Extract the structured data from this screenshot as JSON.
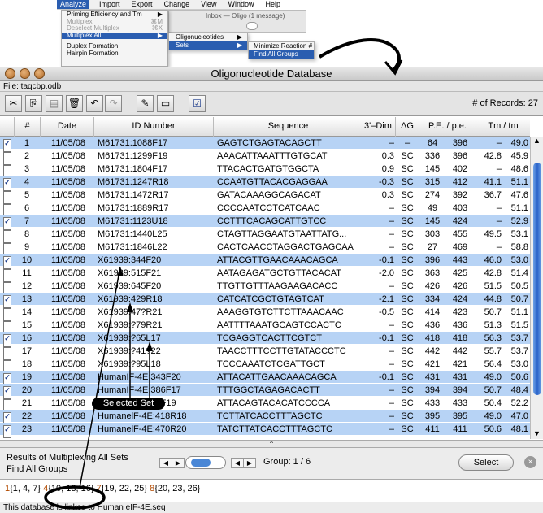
{
  "menubar": {
    "items": [
      "Analyze",
      "Import",
      "Export",
      "Change",
      "View",
      "Window",
      "Help"
    ]
  },
  "analyze_menu": {
    "items": [
      {
        "label": "Priming Efficiency and Tm",
        "shortcut": "▶"
      },
      {
        "label": "Multiplex",
        "shortcut": "⌘M"
      },
      {
        "label": "Deselect Multiplex",
        "shortcut": "⌘X"
      },
      {
        "label": "Multiplex All",
        "shortcut": "▶"
      },
      {
        "label": "Duplex Formation",
        "shortcut": ""
      },
      {
        "label": "Hairpin Formation",
        "shortcut": ""
      }
    ]
  },
  "multiplex_all_menu": {
    "items": [
      {
        "label": "Oligonucleotides",
        "shortcut": "▶"
      },
      {
        "label": "Sets",
        "shortcut": "▶"
      }
    ]
  },
  "sets_menu": {
    "items": [
      "Minimize Reaction #",
      "Find All Groups"
    ]
  },
  "inbox_strip": {
    "title": "Inbox — Oligo (1 message)"
  },
  "window": {
    "title": "Oligonucleotide Database",
    "file": "File: taqcbp.odb"
  },
  "toolbar": {
    "records_label": "# of Records: 27"
  },
  "columns": {
    "num": "#",
    "date": "Date",
    "id": "ID Number",
    "seq": "Sequence",
    "dim": "3'–Dim.",
    "dg": "ΔG",
    "pe": "P.E. / p.e.",
    "tm": "Tm / tm"
  },
  "rows": [
    {
      "checked": true,
      "hl": true,
      "num": "1",
      "date": "11/05/08",
      "id": "M61731:1088F17",
      "seq": "GAGTCTGAGTACAGCTT",
      "dim": "–",
      "dg": "–",
      "pe": "64",
      "pes": "396",
      "tm": "–",
      "tm2": "49.0"
    },
    {
      "checked": false,
      "hl": false,
      "num": "2",
      "date": "11/05/08",
      "id": "M61731:1299F19",
      "seq": "AAACATTAAATTTGTGCAT",
      "dim": "0.3",
      "dg": "SC",
      "pe": "336",
      "pes": "396",
      "tm": "42.8",
      "tm2": "45.9"
    },
    {
      "checked": false,
      "hl": false,
      "num": "3",
      "date": "11/05/08",
      "id": "M61731:1804F17",
      "seq": "TTACACTGATGTGGCTA",
      "dim": "0.9",
      "dg": "SC",
      "pe": "145",
      "pes": "402",
      "tm": "–",
      "tm2": "48.6"
    },
    {
      "checked": true,
      "hl": true,
      "num": "4",
      "date": "11/05/08",
      "id": "M61731:1247R18",
      "seq": "CCAATGTTACACGAGGAA",
      "dim": "-0.3",
      "dg": "SC",
      "pe": "315",
      "pes": "412",
      "tm": "41.1",
      "tm2": "51.1"
    },
    {
      "checked": false,
      "hl": false,
      "num": "5",
      "date": "11/05/08",
      "id": "M61731:1472R17",
      "seq": "GATACAAAGGCAGACAT",
      "dim": "0.3",
      "dg": "SC",
      "pe": "274",
      "pes": "392",
      "tm": "36.7",
      "tm2": "47.6"
    },
    {
      "checked": false,
      "hl": false,
      "num": "6",
      "date": "11/05/08",
      "id": "M61731:1889R17",
      "seq": "CCCCAATCCTCATCAAC",
      "dim": "–",
      "dg": "SC",
      "pe": "49",
      "pes": "403",
      "tm": "–",
      "tm2": "51.1"
    },
    {
      "checked": true,
      "hl": true,
      "num": "7",
      "date": "11/05/08",
      "id": "M61731:1123U18",
      "seq": "CCTTTCACAGCATTGTCC",
      "dim": "–",
      "dg": "SC",
      "pe": "145",
      "pes": "424",
      "tm": "–",
      "tm2": "52.9"
    },
    {
      "checked": false,
      "hl": false,
      "num": "8",
      "date": "11/05/08",
      "id": "M61731:1440L25",
      "seq": "CTAGTTAGGAATGTAATTATG...",
      "dim": "–",
      "dg": "SC",
      "pe": "303",
      "pes": "455",
      "tm": "49.5",
      "tm2": "53.1"
    },
    {
      "checked": false,
      "hl": false,
      "num": "9",
      "date": "11/05/08",
      "id": "M61731:1846L22",
      "seq": "CACTCAACCTAGGACTGAGCAA",
      "dim": "–",
      "dg": "SC",
      "pe": "27",
      "pes": "469",
      "tm": "–",
      "tm2": "58.8"
    },
    {
      "checked": true,
      "hl": true,
      "num": "10",
      "date": "11/05/08",
      "id": "X61939:344F20",
      "seq": "ATTACGTTGAACAAACAGCA",
      "dim": "-0.1",
      "dg": "SC",
      "pe": "396",
      "pes": "443",
      "tm": "46.0",
      "tm2": "53.0"
    },
    {
      "checked": false,
      "hl": false,
      "num": "11",
      "date": "11/05/08",
      "id": "X61939:515F21",
      "seq": "AATAGAGATGCTGTTACACAT",
      "dim": "-2.0",
      "dg": "SC",
      "pe": "363",
      "pes": "425",
      "tm": "42.8",
      "tm2": "51.4"
    },
    {
      "checked": false,
      "hl": false,
      "num": "12",
      "date": "11/05/08",
      "id": "X61939:645F20",
      "seq": "TTGTTGTTTAAGAAGACACC",
      "dim": "–",
      "dg": "SC",
      "pe": "426",
      "pes": "426",
      "tm": "51.5",
      "tm2": "50.5"
    },
    {
      "checked": true,
      "hl": true,
      "num": "13",
      "date": "11/05/08",
      "id": "X61939:429R18",
      "seq": "CATCATCGCTGTAGTCAT",
      "dim": "-2.1",
      "dg": "SC",
      "pe": "334",
      "pes": "424",
      "tm": "44.8",
      "tm2": "50.7"
    },
    {
      "checked": false,
      "hl": false,
      "num": "14",
      "date": "11/05/08",
      "id": "X61939:47?R21",
      "seq": "AAAGGTGTCTTCTTAAACAAC",
      "dim": "-0.5",
      "dg": "SC",
      "pe": "414",
      "pes": "423",
      "tm": "50.7",
      "tm2": "51.1"
    },
    {
      "checked": false,
      "hl": false,
      "num": "15",
      "date": "11/05/08",
      "id": "X61939:?79R21",
      "seq": "AATTTTAAATGCAGTCCACTC",
      "dim": "–",
      "dg": "SC",
      "pe": "436",
      "pes": "436",
      "tm": "51.3",
      "tm2": "51.5"
    },
    {
      "checked": true,
      "hl": true,
      "num": "16",
      "date": "11/05/08",
      "id": "X61939:?65L17",
      "seq": "TCGAGGTCACTTCGTCT",
      "dim": "-0.1",
      "dg": "SC",
      "pe": "418",
      "pes": "418",
      "tm": "56.3",
      "tm2": "53.7"
    },
    {
      "checked": false,
      "hl": false,
      "num": "17",
      "date": "11/05/08",
      "id": "X61939:?41?22",
      "seq": "TAACCTTTCCTTGTATACCCTC",
      "dim": "–",
      "dg": "SC",
      "pe": "442",
      "pes": "442",
      "tm": "55.7",
      "tm2": "53.7"
    },
    {
      "checked": false,
      "hl": false,
      "num": "18",
      "date": "11/05/08",
      "id": "X61939:?95L18",
      "seq": "TCCCAAATCTCGATTGCT",
      "dim": "–",
      "dg": "SC",
      "pe": "421",
      "pes": "421",
      "tm": "56.4",
      "tm2": "53.0"
    },
    {
      "checked": true,
      "hl": true,
      "num": "19",
      "date": "11/05/08",
      "id": "HumanIF-4E:343F20",
      "seq": "ATTACATTGAACAAACAGCA",
      "dim": "-0.1",
      "dg": "SC",
      "pe": "431",
      "pes": "431",
      "tm": "49.0",
      "tm2": "50.6"
    },
    {
      "checked": true,
      "hl": true,
      "num": "20",
      "date": "11/05/08",
      "id": "HumanIF-4E:386F17",
      "seq": "TTTGGCTAGAGACACTT",
      "dim": "–",
      "dg": "SC",
      "pe": "394",
      "pes": "394",
      "tm": "50.7",
      "tm2": "48.4"
    },
    {
      "checked": false,
      "hl": false,
      "num": "21",
      "date": "11/05/08",
      "id": "HumanIF-4E:?8F19",
      "seq": "ATTACAGTACACATCCCCA",
      "dim": "–",
      "dg": "SC",
      "pe": "433",
      "pes": "433",
      "tm": "50.4",
      "tm2": "52.2"
    },
    {
      "checked": true,
      "hl": true,
      "num": "22",
      "date": "11/05/08",
      "id": "HumanelF-4E:418R18",
      "seq": "TCTTATCACCTTTAGCTC",
      "dim": "–",
      "dg": "SC",
      "pe": "395",
      "pes": "395",
      "tm": "49.0",
      "tm2": "47.0"
    },
    {
      "checked": true,
      "hl": true,
      "num": "23",
      "date": "11/05/08",
      "id": "HumanelF-4E:470R20",
      "seq": "TATCTTATCACCTTTAGCTC",
      "dim": "–",
      "dg": "SC",
      "pe": "411",
      "pes": "411",
      "tm": "50.6",
      "tm2": "48.1"
    }
  ],
  "divider": {
    "handle": "^"
  },
  "bottom": {
    "results_line1": "Results of Multiplexing All Sets",
    "results_line2": "Find All Groups",
    "group_label": "Group: 1 / 6",
    "select_label": "Select",
    "stop_icon": "×",
    "sets_parts": [
      {
        "idx": "1",
        "set": "{1, 4, 7}"
      },
      {
        "idx": "4",
        "set": "{10, 13, 16}"
      },
      {
        "idx": "7",
        "set": "{19, 22, 25}"
      },
      {
        "idx": "8",
        "set": "{20, 23, 26}"
      }
    ],
    "status": "This database is linked to Human eIF-4E.seq"
  },
  "annotation": {
    "selected_set": "Selected Set"
  }
}
